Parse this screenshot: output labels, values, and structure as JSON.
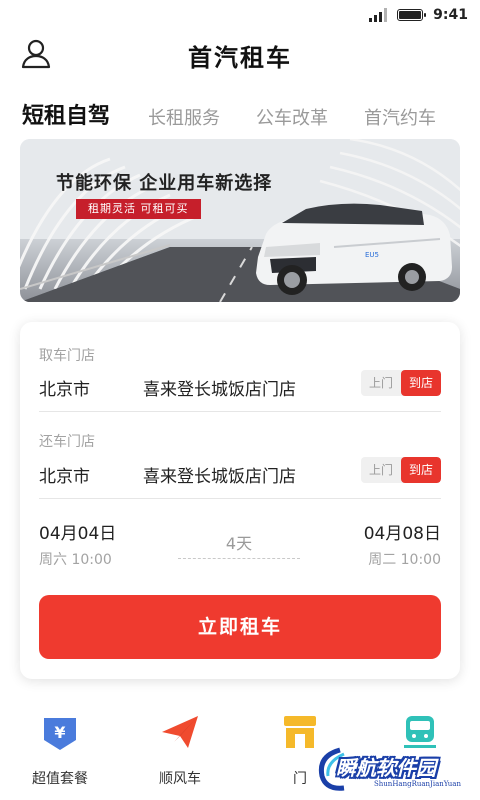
{
  "status_bar": {
    "time": "9:41",
    "signal_icon": "cellular-signal-icon",
    "battery_icon": "battery-icon"
  },
  "header": {
    "title": "首汽租车",
    "user_icon": "user-profile-icon"
  },
  "tabs": [
    {
      "label": "短租自驾",
      "active": true
    },
    {
      "label": "长租服务",
      "active": false
    },
    {
      "label": "公车改革",
      "active": false
    },
    {
      "label": "首汽约车",
      "active": false
    }
  ],
  "banner": {
    "headline": "节能环保  企业用车新选择",
    "tag": "租期灵活    可租可买"
  },
  "booking": {
    "pickup": {
      "label": "取车门店",
      "city": "北京市",
      "store": "喜来登长城饭店门店",
      "option_door": "上门",
      "option_store": "到店",
      "selected": "到店"
    },
    "return": {
      "label": "还车门店",
      "city": "北京市",
      "store": "喜来登长城饭店门店",
      "option_door": "上门",
      "option_store": "到店",
      "selected": "到店"
    },
    "start": {
      "date": "04月04日",
      "weekday_time": "周六 10:00"
    },
    "duration": "4天",
    "end": {
      "date": "04月08日",
      "weekday_time": "周二 10:00"
    },
    "submit_label": "立即租车"
  },
  "bottom_nav": [
    {
      "label": "超值套餐",
      "icon": "yen-shield-icon",
      "color": "#4a7bdc"
    },
    {
      "label": "顺风车",
      "icon": "paper-plane-icon",
      "color": "#f04b2f"
    },
    {
      "label": "门",
      "icon": "storefront-icon",
      "color": "#f5b92a"
    },
    {
      "label": "",
      "icon": "train-icon",
      "color": "#2fc1b8"
    }
  ],
  "watermark": {
    "title": "瞬航软件园",
    "subtitle": "ShunHangRuanJianYuan"
  },
  "colors": {
    "accent": "#ef3a2f",
    "toggle_on": "#e8352d",
    "muted_text": "#a3a3a3"
  }
}
